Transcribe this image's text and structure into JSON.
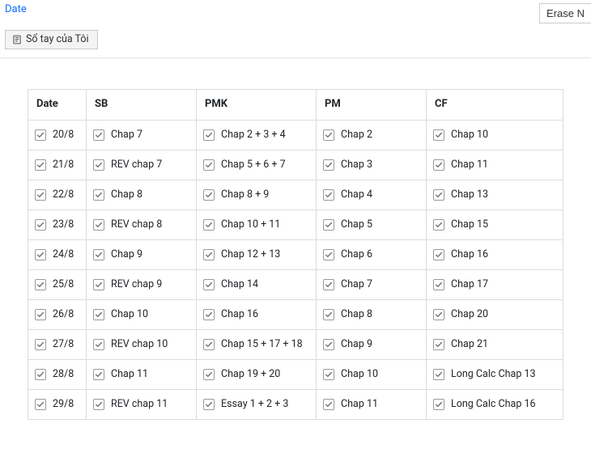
{
  "top": {
    "link_text": "Date",
    "erase_label": "Erase N",
    "tab_label": "Sổ tay của Tôi"
  },
  "table": {
    "headers": [
      "Date",
      "SB",
      "PMK",
      "PM",
      "CF"
    ],
    "rows": [
      {
        "date": "20/8",
        "sb": "Chap 7",
        "pmk": "Chap 2 + 3 + 4",
        "pm": "Chap 2",
        "cf": "Chap 10"
      },
      {
        "date": "21/8",
        "sb": "REV chap 7",
        "pmk": "Chap 5 + 6 + 7",
        "pm": "Chap 3",
        "cf": "Chap 11"
      },
      {
        "date": "22/8",
        "sb": "Chap 8",
        "pmk": "Chap 8 + 9",
        "pm": "Chap 4",
        "cf": "Chap 13"
      },
      {
        "date": "23/8",
        "sb": "REV chap 8",
        "pmk": "Chap 10 + 11",
        "pm": "Chap 5",
        "cf": "Chap 15"
      },
      {
        "date": "24/8",
        "sb": "Chap 9",
        "pmk": "Chap 12 + 13",
        "pm": "Chap 6",
        "cf": "Chap 16"
      },
      {
        "date": "25/8",
        "sb": "REV chap 9",
        "pmk": "Chap 14",
        "pm": "Chap 7",
        "cf": "Chap 17"
      },
      {
        "date": "26/8",
        "sb": "Chap 10",
        "pmk": "Chap 16",
        "pm": "Chap 8",
        "cf": "Chap 20"
      },
      {
        "date": "27/8",
        "sb": "REV chap 10",
        "pmk": "Chap 15 + 17 + 18",
        "pm": "Chap 9",
        "cf": "Chap 21"
      },
      {
        "date": "28/8",
        "sb": "Chap 11",
        "pmk": "Chap 19 + 20",
        "pm": "Chap 10",
        "cf": "Long Calc Chap 13"
      },
      {
        "date": "29/8",
        "sb": "REV chap 11",
        "pmk": "Essay 1 + 2 + 3",
        "pm": "Chap 11",
        "cf": "Long Calc Chap 16"
      }
    ]
  }
}
